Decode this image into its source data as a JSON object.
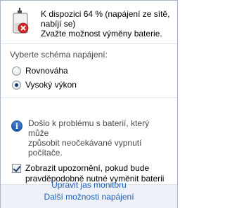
{
  "status": {
    "battery_line": "K dispozici 64 % (napájení ze sítě,",
    "charging_line": "nabíjí se)",
    "advice_line": "Zvažte možnost výměny baterie."
  },
  "plan": {
    "title": "Vyberte schéma napájení:",
    "options": [
      {
        "label": "Rovnováha",
        "selected": false
      },
      {
        "label": "Vysoký výkon",
        "selected": true
      }
    ]
  },
  "warning": {
    "line1": "Došlo k problému s baterií, který může",
    "line2": "způsobit neočekávané vypnutí",
    "line3": "počítače."
  },
  "notify": {
    "line1": "Zobrazit upozornění, pokud bude",
    "line2": "pravděpodobně nutné vyměnit baterii",
    "checked": true
  },
  "footer": {
    "link1": "Upravit jas monitoru",
    "link2": "Další možnosti napájení"
  }
}
